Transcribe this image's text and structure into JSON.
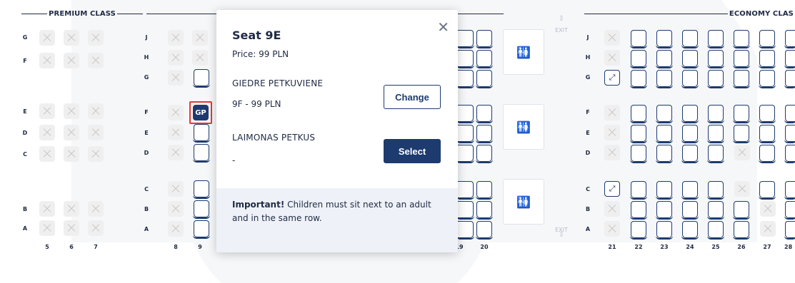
{
  "premium_class": {
    "label": "PREMIUM CLASS"
  },
  "economy_class": {
    "label": "ECONOMY CLAS"
  },
  "exit": {
    "label": "EXIT"
  },
  "row_letters_left": [
    "G",
    "F",
    "E",
    "D",
    "C",
    "B",
    "A"
  ],
  "row_letters_mid": [
    "J",
    "H",
    "G",
    "F",
    "E",
    "D",
    "C",
    "B",
    "A"
  ],
  "row_letters_right": [
    "J",
    "H",
    "G",
    "F",
    "E",
    "D",
    "C",
    "B",
    "A"
  ],
  "columns_premium": [
    "5",
    "6",
    "7"
  ],
  "columns_mid": [
    "8",
    "9"
  ],
  "columns_hidden_right": [
    "19",
    "20"
  ],
  "columns_economy": [
    "21",
    "22",
    "23",
    "24",
    "25",
    "26",
    "27",
    "28"
  ],
  "occupied_seat": {
    "initials": "GP"
  },
  "popup": {
    "title": "Seat 9E",
    "price": "Price: 99 PLN",
    "passenger1_name": "GIEDRE PETKUVIENE",
    "passenger1_seat": "9F - 99 PLN",
    "change_label": "Change",
    "passenger2_name": "LAIMONAS PETKUS",
    "passenger2_seat": "-",
    "select_label": "Select",
    "notice_bold": "Important!",
    "notice_text": " Children must sit next to an adult and in the same row.",
    "close_icon": "close-icon"
  },
  "colors": {
    "navy": "#1d3b6e",
    "highlight": "#e53935",
    "unavailable": "#efefef"
  }
}
